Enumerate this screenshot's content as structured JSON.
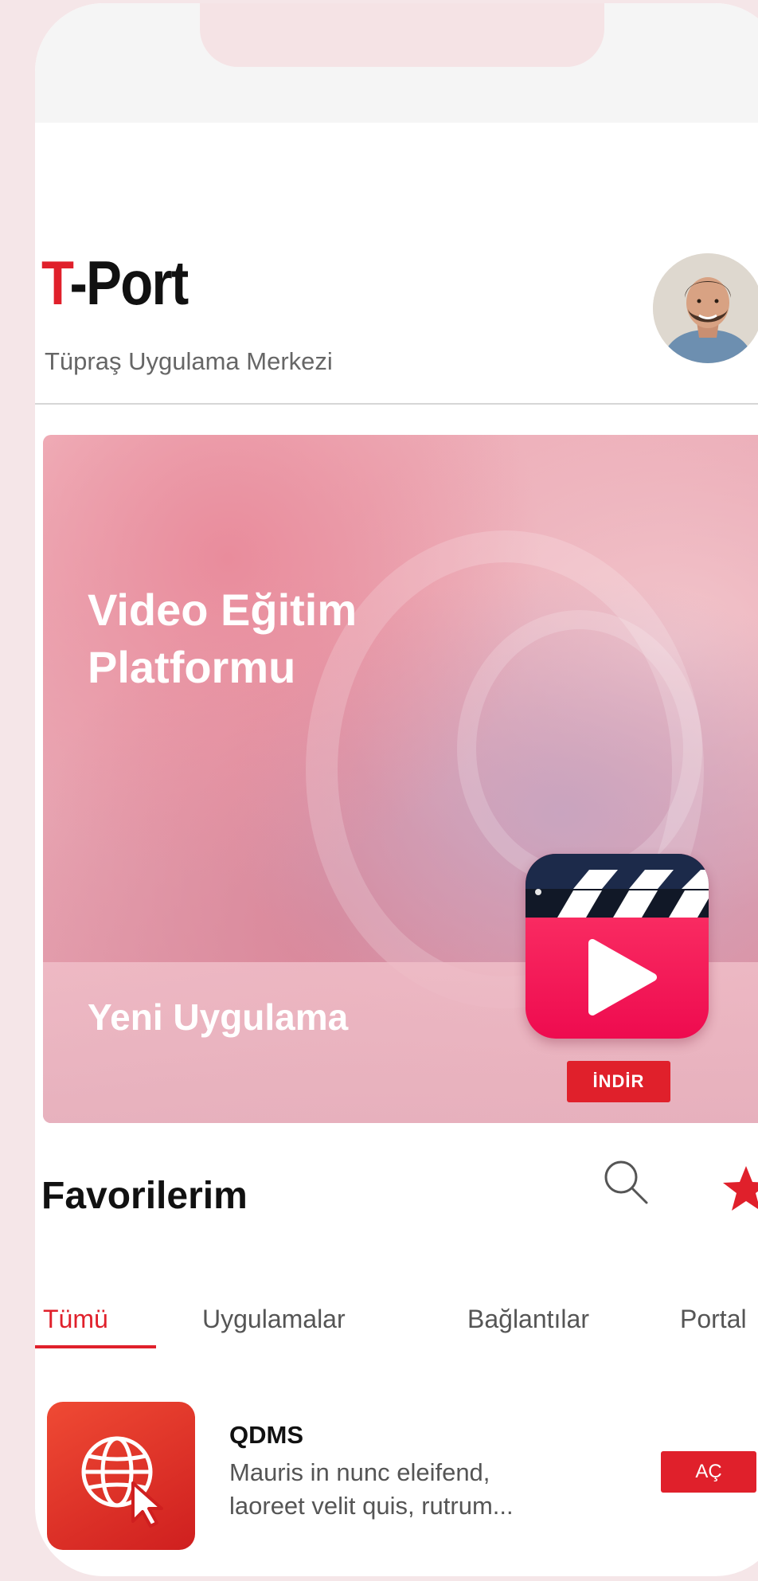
{
  "header": {
    "title_accent": "T",
    "title_rest": "-Port",
    "subtitle": "Tüpraş Uygulama Merkezi"
  },
  "banner": {
    "heading_line1": "Video Eğitim",
    "heading_line2": "Platformu",
    "tag": "Yeni Uygulama",
    "download_label": "İNDİR",
    "app_icon": "video-clapperboard-icon"
  },
  "favorites": {
    "title": "Favorilerim",
    "tabs": [
      {
        "label": "Tümü",
        "active": true
      },
      {
        "label": "Uygulamalar",
        "active": false
      },
      {
        "label": "Bağlantılar",
        "active": false
      },
      {
        "label": "Portal",
        "active": false
      }
    ],
    "items": [
      {
        "title": "QDMS",
        "description": "Mauris in nunc eleifend, laoreet velit quis, rutrum...",
        "action_label": "AÇ",
        "icon": "globe-cursor-icon"
      }
    ]
  },
  "colors": {
    "accent": "#e0202b",
    "banner_pink": "#e6a1af"
  }
}
